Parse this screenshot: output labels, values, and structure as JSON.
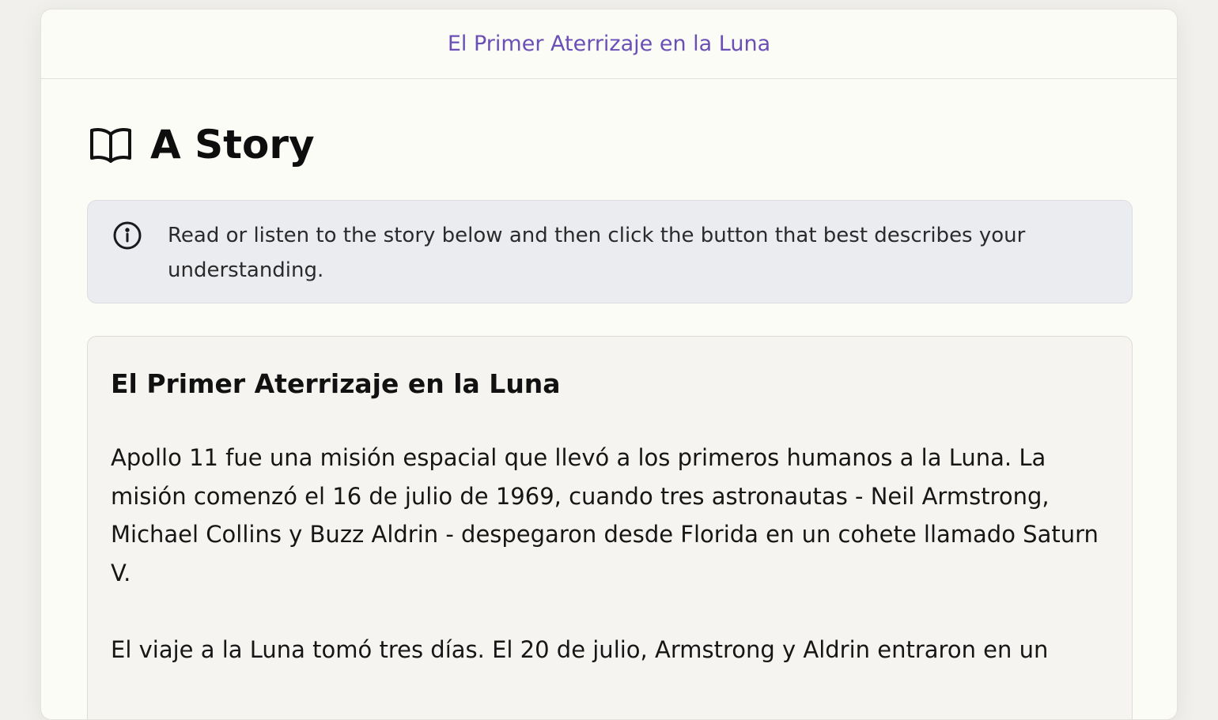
{
  "header": {
    "title": "El Primer Aterrizaje en la Luna"
  },
  "page": {
    "title": "A Story",
    "title_icon": "book-open-icon"
  },
  "info": {
    "icon": "info-icon",
    "text": "Read or listen to the story below and then click the button that best describes your understanding."
  },
  "story": {
    "title": "El Primer Aterrizaje en la Luna",
    "paragraphs": [
      "Apollo 11 fue una misión espacial que llevó a los primeros humanos a la Luna. La misión comenzó el 16 de julio de 1969, cuando tres astronautas - Neil Armstrong, Michael Collins y Buzz Aldrin - despegaron desde Florida en un cohete llamado Saturn V.",
      "El viaje a la Luna tomó tres días. El 20 de julio, Armstrong y Aldrin entraron en un"
    ]
  },
  "colors": {
    "accent": "#6a4fb6",
    "card_bg": "#fcfcf6",
    "info_bg": "#ebecf0",
    "story_bg": "#f5f4f0"
  }
}
